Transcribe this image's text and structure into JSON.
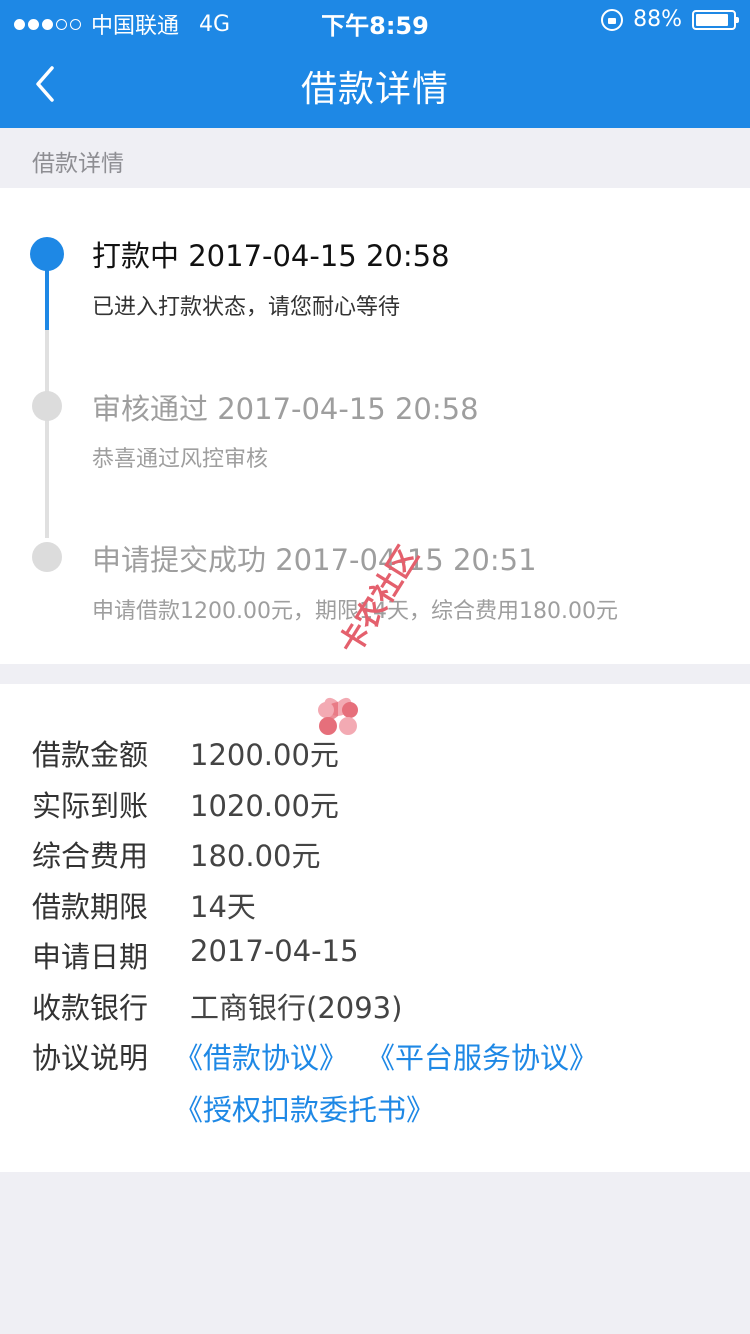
{
  "status_bar": {
    "carrier": "中国联通",
    "network": "4G",
    "time": "下午8:59",
    "battery": "88%",
    "battery_level": 0.88
  },
  "nav": {
    "title": "借款详情",
    "back_icon": "chevron-left-icon"
  },
  "section_header": "借款详情",
  "timeline": [
    {
      "title": "打款中 2017-04-15 20:58",
      "desc": "已进入打款状态，请您耐心等待",
      "state": "active"
    },
    {
      "title": "审核通过 2017-04-15 20:58",
      "desc": "恭喜通过风控审核",
      "state": "done"
    },
    {
      "title": "申请提交成功 2017-04-15 20:51",
      "desc": "申请借款1200.00元，期限14天，综合费用180.00元",
      "state": "done"
    }
  ],
  "details": [
    {
      "label": "借款金额",
      "value": "1200.00元"
    },
    {
      "label": "实际到账",
      "value": "1020.00元"
    },
    {
      "label": "综合费用",
      "value": "180.00元"
    },
    {
      "label": "借款期限",
      "value": "14天"
    },
    {
      "label": "申请日期",
      "value": "2017-04-15"
    },
    {
      "label": "收款银行",
      "value": "工商银行(2093)"
    }
  ],
  "agreements": {
    "label": "协议说明",
    "links": [
      "《借款协议》",
      "《平台服务协议》",
      "《授权扣款委托书》"
    ]
  },
  "watermark": {
    "text": "卡农社区"
  },
  "colors": {
    "accent": "#1e88e5",
    "background": "#efeff4",
    "inactive_dot": "#dcdcdc",
    "watermark": "#e4606d"
  }
}
